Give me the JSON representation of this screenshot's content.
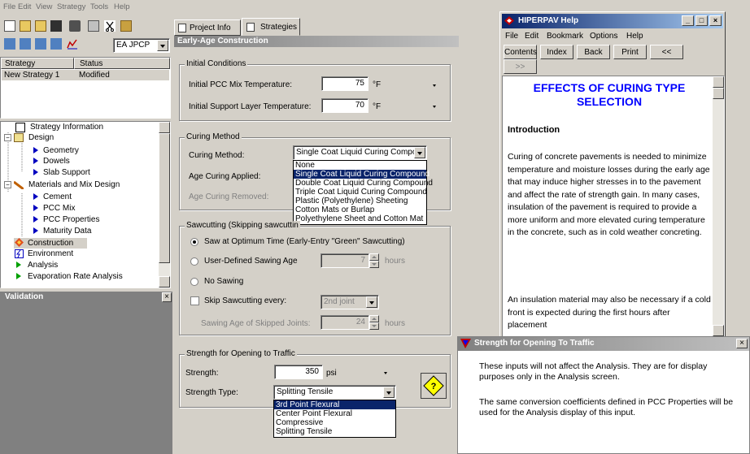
{
  "menu": {
    "file": "File",
    "edit": "Edit",
    "view": "View",
    "strategy": "Strategy",
    "tools": "Tools",
    "help": "Help"
  },
  "toolbar": {
    "strategy_combo": "EA JPCP"
  },
  "strategy_list": {
    "headers": {
      "strategy": "Strategy",
      "status": "Status"
    },
    "rows": [
      {
        "strategy": "New Strategy 1",
        "status": "Modified"
      }
    ]
  },
  "tree": {
    "strategy_info": "Strategy Information",
    "design": "Design",
    "geometry": "Geometry",
    "dowels": "Dowels",
    "slab_support": "Slab Support",
    "materials": "Materials and Mix Design",
    "cement": "Cement",
    "pcc_mix": "PCC Mix",
    "pcc_properties": "PCC Properties",
    "maturity": "Maturity Data",
    "construction": "Construction",
    "environment": "Environment",
    "analysis": "Analysis",
    "evaporation": "Evaporation Rate Analysis"
  },
  "validation": {
    "title": "Validation",
    "close": "×"
  },
  "tabs": {
    "project_info": "Project Info",
    "strategies": "Strategies"
  },
  "panel": {
    "title": "Early-Age Construction"
  },
  "initial_conditions": {
    "title": "Initial Conditions",
    "pcc_temp_label": "Initial PCC Mix Temperature:",
    "pcc_temp_value": "75",
    "support_temp_label": "Initial Support Layer Temperature:",
    "support_temp_value": "70",
    "unit": "°F"
  },
  "curing": {
    "title": "Curing Method",
    "method_label": "Curing Method:",
    "method_value": "Single Coat Liquid Curing Compound",
    "applied_label": "Age Curing Applied:",
    "removed_label": "Age Curing Removed:",
    "options": [
      "None",
      "Single Coat Liquid Curing Compound",
      "Double Coat Liquid Curing Compound",
      "Triple Coat Liquid Curing Compound",
      "Plastic (Polyethylene) Sheeting",
      "Cotton Mats or Burlap",
      "Polyethylene Sheet and Cotton Mat"
    ]
  },
  "sawcutting": {
    "title": "Sawcutting (Skipping sawcuttin",
    "optimum": "Saw at Optimum Time (Early-Entry \"Green\" Sawcutting)",
    "user_defined": "User-Defined Sawing Age",
    "user_value": "7",
    "no_sawing": "No Sawing",
    "skip": "Skip Sawcutting every:",
    "skip_value": "2nd joint",
    "skipped_age_label": "Sawing Age of Skipped Joints:",
    "skipped_age_value": "24",
    "hours": "hours"
  },
  "strength": {
    "title": "Strength for Opening to Traffic",
    "strength_label": "Strength:",
    "strength_value": "350",
    "unit": "psi",
    "type_label": "Strength Type:",
    "type_value": "Splitting Tensile",
    "options": [
      "3rd Point Flexural",
      "Center Point Flexural",
      "Compressive",
      "Splitting Tensile"
    ]
  },
  "help_window": {
    "title": "HIPERPAV Help",
    "menu": {
      "file": "File",
      "edit": "Edit",
      "bookmark": "Bookmark",
      "options": "Options",
      "help": "Help"
    },
    "buttons": {
      "contents": "Contents",
      "index": "Index",
      "back": "Back",
      "print": "Print",
      "prev": "<<",
      "next": ">>"
    },
    "heading": "EFFECTS OF CURING TYPE SELECTION",
    "section": "Introduction",
    "para1": "Curing of concrete pavements is needed to minimize temperature and moisture losses during the early age that may induce higher stresses in to the pavement and affect the rate of strength gain.  In many cases, insulation of the pavement is required to provide a more uniform and more elevated curing temperature in the concrete, such as in cold weather concreting.",
    "para2": "An insulation material may also be necessary if a cold front is expected during the first hours after placement"
  },
  "tip_window": {
    "title": "Strength for Opening To Traffic",
    "close": "×",
    "para1": "These inputs will not affect the Analysis. They are for display purposes only in the Analysis screen.",
    "para2": "The same conversion coefficients defined in PCC Properties will be used for the Analysis display of this input."
  }
}
